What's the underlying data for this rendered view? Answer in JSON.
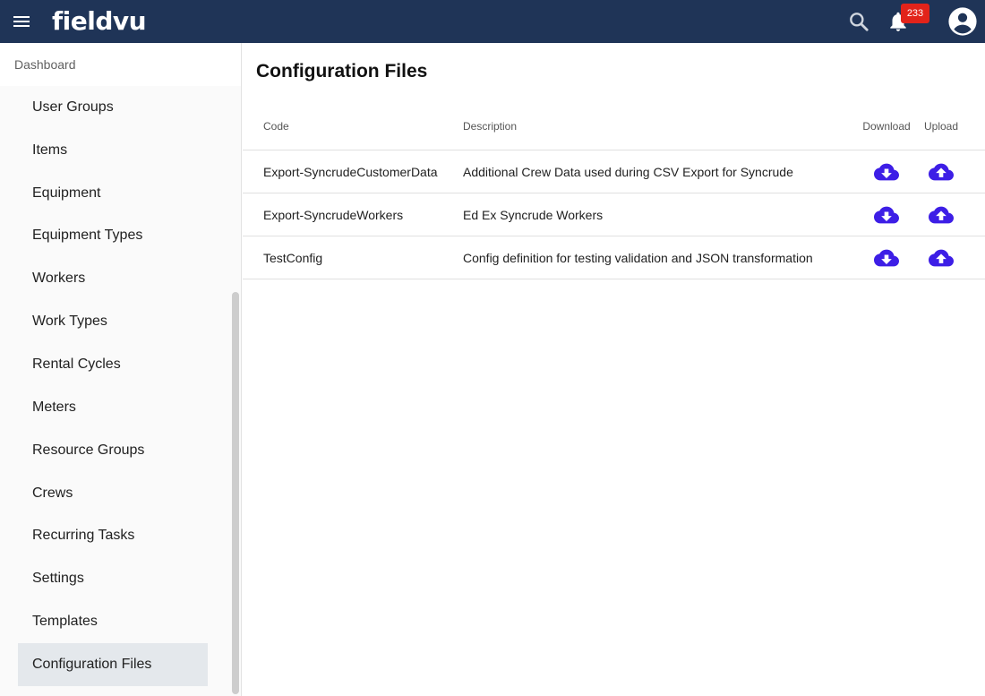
{
  "header": {
    "logo": "fieldvu",
    "notifications_count": "233",
    "icons": [
      "menu-icon",
      "search-icon",
      "bell-icon",
      "account-circle-icon"
    ],
    "colors": {
      "bar": "#1f3457",
      "badge": "#e2231a"
    }
  },
  "sidebar": {
    "heading": "Dashboard",
    "items": [
      {
        "label": "User Groups"
      },
      {
        "label": "Items"
      },
      {
        "label": "Equipment"
      },
      {
        "label": "Equipment Types"
      },
      {
        "label": "Workers"
      },
      {
        "label": "Work Types"
      },
      {
        "label": "Rental Cycles"
      },
      {
        "label": "Meters"
      },
      {
        "label": "Resource Groups"
      },
      {
        "label": "Crews"
      },
      {
        "label": "Recurring Tasks"
      },
      {
        "label": "Settings"
      },
      {
        "label": "Templates"
      },
      {
        "label": "Configuration Files"
      }
    ],
    "active_item": "Configuration Files"
  },
  "main": {
    "title": "Configuration Files",
    "table": {
      "columns": {
        "code": "Code",
        "description": "Description",
        "download": "Download",
        "upload": "Upload"
      },
      "rows": [
        {
          "code": "Export-SyncrudeCustomerData",
          "description": "Additional Crew Data used during CSV Export for Syncrude"
        },
        {
          "code": "Export-SyncrudeWorkers",
          "description": "Ed Ex Syncrude Workers"
        },
        {
          "code": "TestConfig",
          "description": "Config definition for testing validation and JSON transformation"
        }
      ],
      "icons": {
        "download": "cloud-download-icon",
        "upload": "cloud-upload-icon",
        "color": "#3d1ee6"
      }
    }
  }
}
